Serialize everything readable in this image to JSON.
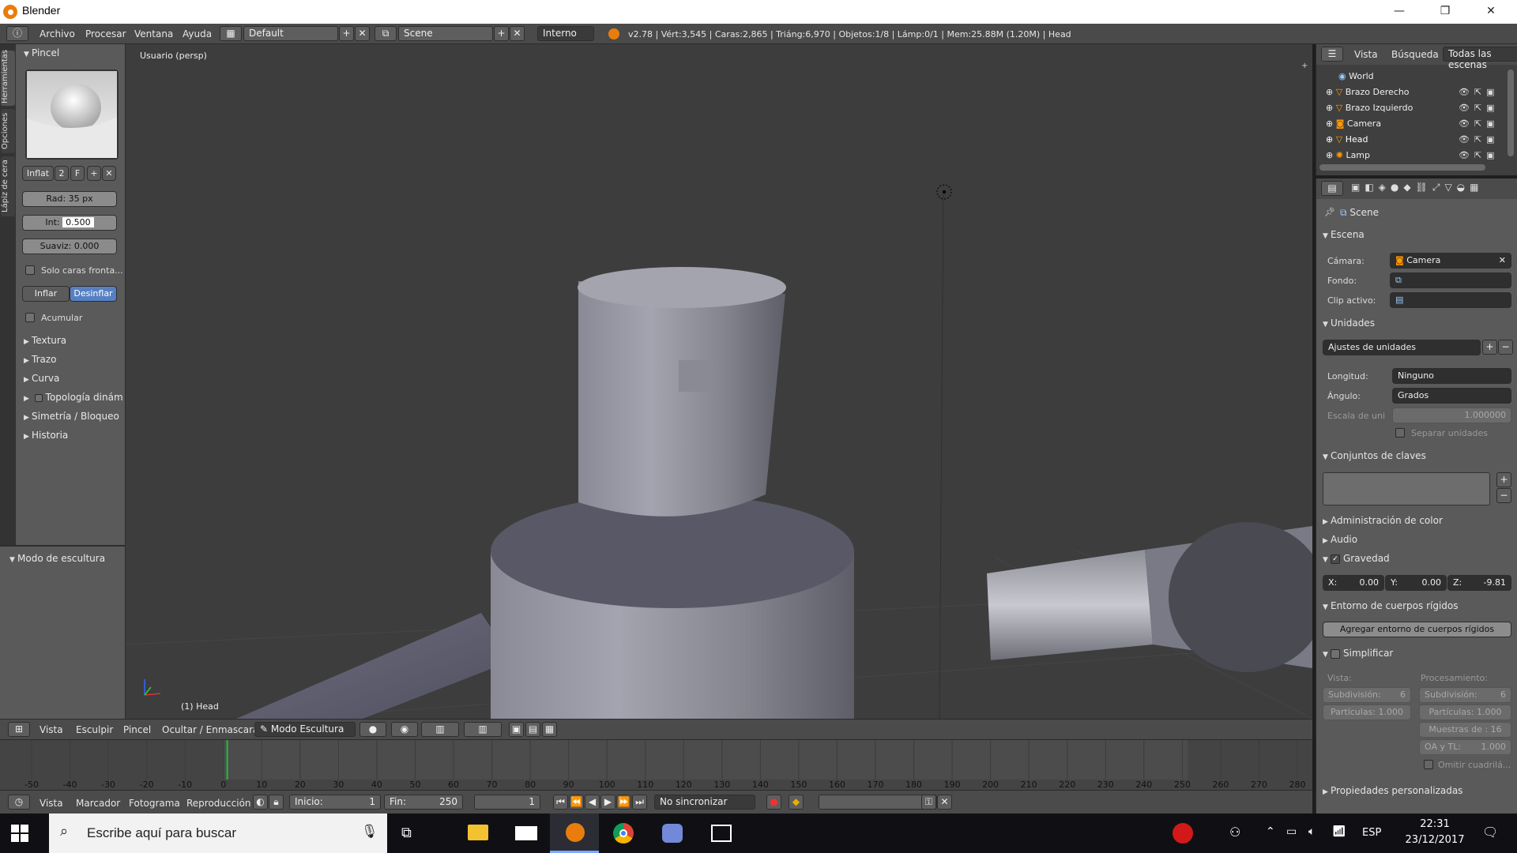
{
  "window": {
    "title": "Blender",
    "minimize": "—",
    "restore": "❐",
    "close": "✕"
  },
  "infobar": {
    "menus": [
      "Archivo",
      "Procesar",
      "Ventana",
      "Ayuda"
    ],
    "screen_layout": "Default",
    "scene": "Scene",
    "engine": "Interno",
    "stats": "v2.78 | Vért:3,545 | Caras:2,865 | Triáng:6,970 | Objetos:1/8 | Lámp:0/1 | Mem:25.88M (1.20M) | Head"
  },
  "left_tabs": [
    "Herramientas",
    "Opciones",
    "Lápiz de cera"
  ],
  "toolshelf": {
    "panel_title": "Pincel",
    "brush_name": "Inflat",
    "brush_users": "2",
    "brush_fake": "F",
    "radius": "Rad: 35 px",
    "strength_label": "Int:",
    "strength_value": "0.500",
    "smooth": "Suaviz: 0.000",
    "front_faces": "Solo caras fronta...",
    "inflate": "Inflar",
    "deflate": "Desinflar",
    "accumulate": "Acumular",
    "subpanels": [
      "Textura",
      "Trazo",
      "Curva",
      "Topología dinám",
      "Simetría / Bloqueo",
      "Historia"
    ],
    "sculpt_mode_panel": "Modo de escultura"
  },
  "viewport": {
    "view_label": "Usuario (persp)",
    "object_label": "(1) Head"
  },
  "view3d_header": {
    "menus": [
      "Vista",
      "Esculpir",
      "Pincel",
      "Ocultar / Enmascarar"
    ],
    "mode": "Modo Escultura"
  },
  "timeline": {
    "ticks": [
      -50,
      -40,
      -30,
      -20,
      -10,
      0,
      10,
      20,
      30,
      40,
      50,
      60,
      70,
      80,
      90,
      100,
      110,
      120,
      130,
      140,
      150,
      160,
      170,
      180,
      190,
      200,
      210,
      220,
      230,
      240,
      250,
      260,
      270,
      280
    ],
    "current_frame": 1
  },
  "timeline_header": {
    "menus": [
      "Vista",
      "Marcador",
      "Fotograma",
      "Reproducción"
    ],
    "start": "Inicio:",
    "start_val": "1",
    "end": "Fin:",
    "end_val": "250",
    "current": "1",
    "sync": "No sincronizar"
  },
  "outliner": {
    "tabs": [
      "Vista",
      "Búsqueda",
      "Todas las escenas"
    ],
    "items": [
      "World",
      "Brazo Derecho",
      "Brazo Izquierdo",
      "Camera",
      "Head",
      "Lamp"
    ]
  },
  "properties": {
    "context": "Scene",
    "escena": "Escena",
    "camara_label": "Cámara:",
    "camara_value": "Camera",
    "fondo_label": "Fondo:",
    "clip_label": "Clip activo:",
    "unidades": "Unidades",
    "unit_presets": "Ajustes de unidades",
    "longitud_label": "Longitud:",
    "longitud_value": "Ninguno",
    "angulo_label": "Ángulo:",
    "angulo_value": "Grados",
    "escala_label": "Escala de uni",
    "escala_value": "1.000000",
    "separar": "Separar unidades",
    "keying_sets": "Conjuntos de claves",
    "color_mgmt": "Administración de color",
    "audio": "Audio",
    "gravedad": "Gravedad",
    "gx": "X:",
    "gx_val": "0.00",
    "gy": "Y:",
    "gy_val": "0.00",
    "gz": "Z:",
    "gz_val": "-9.81",
    "rigid": "Entorno de cuerpos rígidos",
    "rigid_add": "Agregar entorno de cuerpos rígidos",
    "simplificar": "Simplificar",
    "vista_label": "Vista:",
    "proc_label": "Procesamiento:",
    "subdiv_left": "Subdivisión:",
    "subdiv_left_val": "6",
    "subdiv_right": "Subdivisión:",
    "subdiv_right_val": "6",
    "part_left": "Partículas: 1.000",
    "part_right": "Partículas: 1.000",
    "muestras": "Muestras de : 16",
    "oa": "OA y TL:",
    "oa_val": "1.000",
    "omitir": "Omitir cuadrilá...",
    "custom_props": "Propiedades personalizadas"
  },
  "taskbar": {
    "search_placeholder": "Escribe aquí para buscar",
    "lang": "ESP",
    "time": "22:31",
    "date": "23/12/2017"
  },
  "colors": {
    "accent": "#5680c2",
    "blender_orange": "#e87d0d",
    "viewport_bg": "#3d3d3d"
  }
}
